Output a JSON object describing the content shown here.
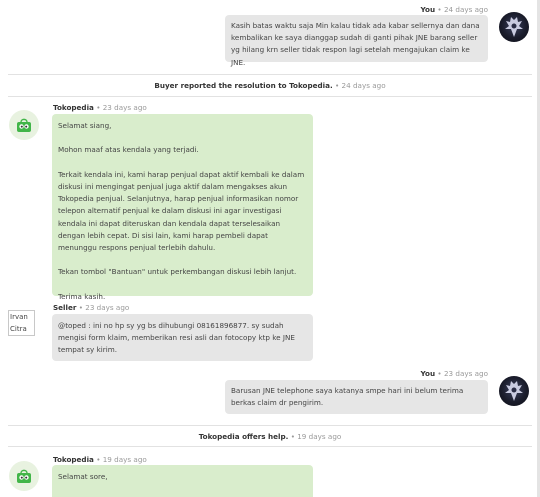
{
  "messages": [
    {
      "sender": "You",
      "time": "24 days ago",
      "text": "Kasih batas waktu saja Min kalau tidak ada kabar sellernya dan dana kembalikan ke saya dianggap sudah di ganti pihak JNE barang seller yg hilang krn seller tidak respon lagi setelah mengajukan claim ke JNE."
    },
    {
      "sender": "Tokopedia",
      "time": "23 days ago",
      "paragraphs": [
        "Selamat siang,",
        "Mohon maaf atas kendala yang terjadi.",
        "Terkait kendala ini, kami harap penjual dapat aktif kembali ke dalam diskusi ini mengingat penjual juga aktif dalam mengakses akun Tokopedia penjual. Selanjutnya, harap penjual informasikan nomor telepon alternatif penjual ke dalam diskusi ini agar investigasi kendala ini dapat diteruskan dan kendala dapat terselesaikan dengan lebih cepat. Di sisi lain, kami harap pembeli dapat menunggu respons penjual terlebih dahulu.",
        "Tekan tombol \"Bantuan\" untuk perkembangan diskusi lebih lanjut.",
        "Terima kasih."
      ]
    },
    {
      "sender": "Seller",
      "time": "23 days ago",
      "name_tag": "Irvan Citra",
      "text": "@toped : ini no hp sy yg bs dihubungi 08161896877. sy sudah mengisi form klaim, memberikan resi asli dan fotocopy ktp ke JNE tempat sy kirim."
    },
    {
      "sender": "You",
      "time": "23 days ago",
      "text": "Barusan JNE telephone saya katanya smpe hari ini belum terima berkas claim dr pengirim."
    },
    {
      "sender": "Tokopedia",
      "time": "19 days ago",
      "text": "Selamat sore,"
    }
  ],
  "system_events": [
    {
      "text": "Buyer reported the resolution to Tokopedia.",
      "time": "24 days ago"
    },
    {
      "text": "Tokopedia offers help.",
      "time": "19 days ago"
    }
  ],
  "separator": "•",
  "icons": {
    "user_avatar": "winged-emblem-icon",
    "tokopedia_avatar": "tokopedia-bag-icon"
  },
  "colors": {
    "bubble_user": "#e6e6e6",
    "bubble_tokopedia": "#d9edcc",
    "tokopedia_green": "#42b549"
  }
}
